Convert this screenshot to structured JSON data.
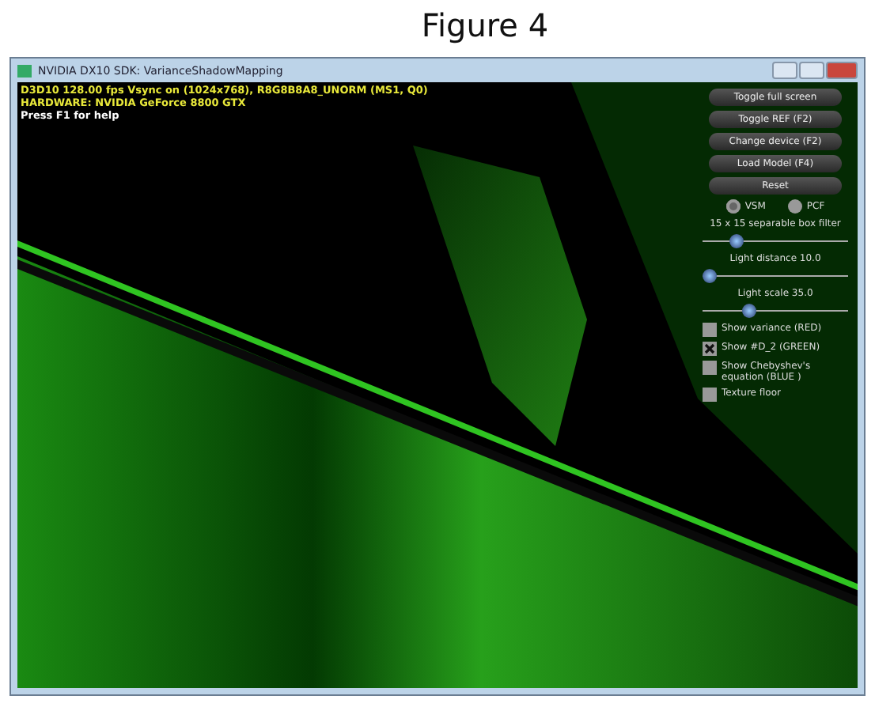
{
  "figure_caption": "Figure 4",
  "window": {
    "title": "NVIDIA DX10 SDK: VarianceShadowMapping"
  },
  "info_lines": [
    {
      "text": "D3D10 128.00 fps Vsync on (1024x768), R8G8B8A8_UNORM (MS1, Q0)",
      "kind": "stat"
    },
    {
      "text": "HARDWARE: NVIDIA GeForce 8800 GTX",
      "kind": "stat"
    },
    {
      "text": "Press F1 for help",
      "kind": "help"
    }
  ],
  "buttons": [
    "Toggle full screen",
    "Toggle REF (F2)",
    "Change device (F2)",
    "Load Model (F4)",
    "Reset"
  ],
  "radios": [
    {
      "label": "VSM",
      "selected": true
    },
    {
      "label": "PCF",
      "selected": false
    }
  ],
  "sliders": [
    {
      "label": "15 x 15 separable box filter",
      "level": 0.2
    },
    {
      "label": "Light distance 10.0",
      "level": 0.0
    },
    {
      "label": "Light scale 35.0",
      "level": 0.3
    }
  ],
  "checkboxes": [
    {
      "label": "Show variance (RED)",
      "checked": false
    },
    {
      "label": "Show #D_2 (GREEN)",
      "checked": true
    },
    {
      "label": "Show Chebyshev's equation (BLUE )",
      "checked": false
    },
    {
      "label": "Texture floor",
      "checked": false
    }
  ]
}
